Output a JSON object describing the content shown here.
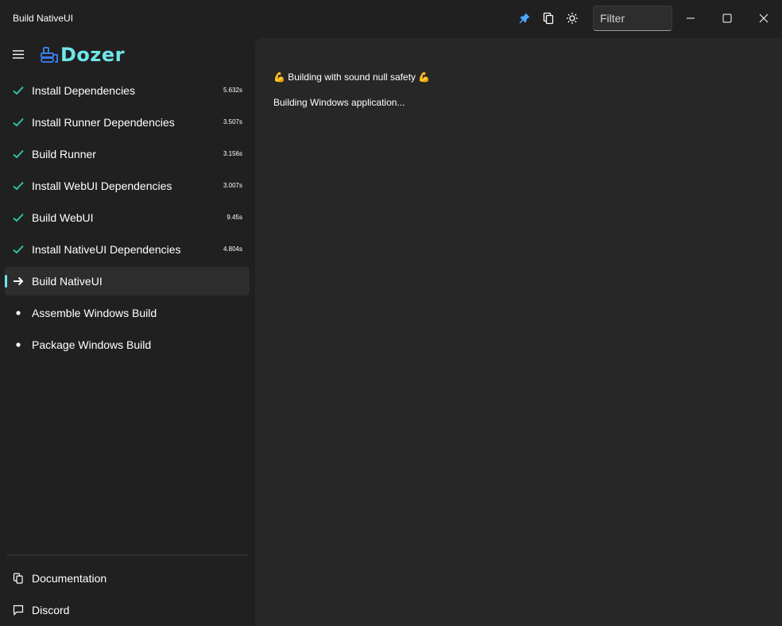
{
  "window": {
    "title": "Build NativeUI"
  },
  "toolbar": {
    "icons": [
      "pin-icon",
      "copy-icon",
      "sun-icon"
    ],
    "filter_placeholder": "Filter",
    "filter_value": ""
  },
  "brand": {
    "name": "Dozer",
    "accent": "#6fe6ea"
  },
  "steps": [
    {
      "label": "Install Dependencies",
      "time": "5.632s",
      "status": "done"
    },
    {
      "label": "Install Runner Dependencies",
      "time": "3.507s",
      "status": "done"
    },
    {
      "label": "Build Runner",
      "time": "3.156s",
      "status": "done"
    },
    {
      "label": "Install WebUI Dependencies",
      "time": "3.007s",
      "status": "done"
    },
    {
      "label": "Build WebUI",
      "time": "9.45s",
      "status": "done"
    },
    {
      "label": "Install NativeUI Dependencies",
      "time": "4.804s",
      "status": "done"
    },
    {
      "label": "Build NativeUI",
      "time": "",
      "status": "running"
    },
    {
      "label": "Assemble Windows Build",
      "time": "",
      "status": "pending"
    },
    {
      "label": "Package Windows Build",
      "time": "",
      "status": "pending"
    }
  ],
  "footer": {
    "documentation": "Documentation",
    "discord": "Discord"
  },
  "log": {
    "lines": [
      "💪 Building with sound null safety 💪",
      "Building Windows application..."
    ]
  },
  "colors": {
    "check": "#2ec4a5",
    "background": "#202020",
    "panel": "#272727"
  }
}
